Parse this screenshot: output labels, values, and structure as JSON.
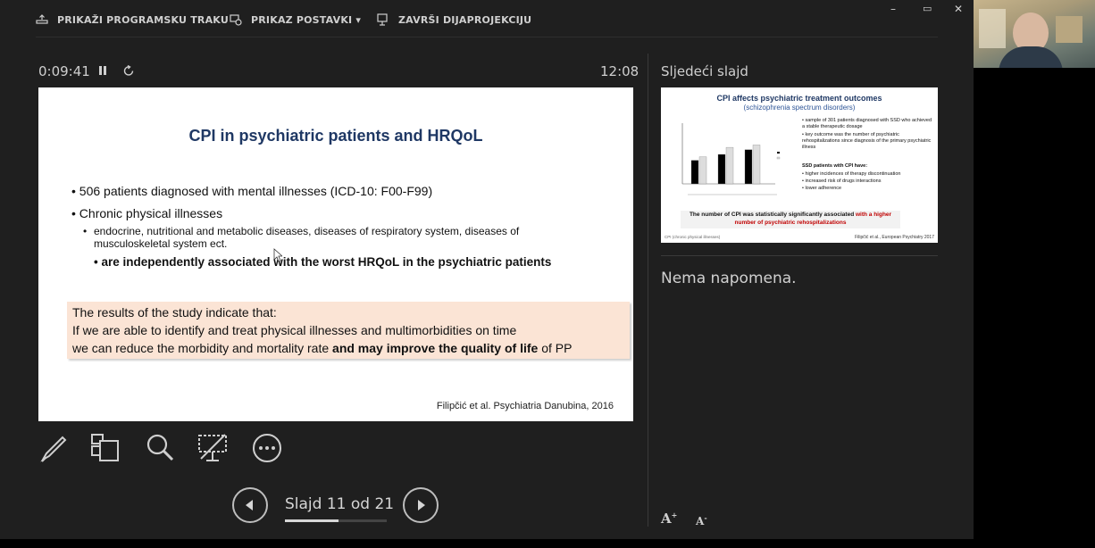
{
  "toolbar": {
    "show_taskbar": "PRIKAŽI PROGRAMSKU TRAKU",
    "display_settings": "PRIKAZ POSTAVKI ▾",
    "end_slideshow": "ZAVRŠI DIJAPROJEKCIJU"
  },
  "window_controls": {
    "minimize": "–",
    "restore": "▭",
    "close": "✕"
  },
  "presenter": {
    "elapsed_time": "0:09:41",
    "current_time": "12:08"
  },
  "current_slide": {
    "title": "CPI in psychiatric patients and HRQoL",
    "bullet1": "• 506 patients diagnosed with mental illnesses (ICD-10: F00-F99)",
    "bullet2": "• Chronic physical illnesses",
    "sub1": "endocrine, nutritional and metabolic diseases, diseases of respiratory system, diseases of musculoskeletal system ect.",
    "sub2": "• are independently associated with the worst HRQoL in the psychiatric patients",
    "box_line1": "The results of the study indicate that:",
    "box_line2": "If we are able to identify and treat physical illnesses and multimorbidities on time",
    "box_line3_a": "we can reduce the morbidity and mortality rate ",
    "box_line3_b": "and may improve the quality of life",
    "box_line3_c": " of PP",
    "citation": "Filipčić et al. Psychiatria Danubina, 2016"
  },
  "navigation": {
    "slide_counter": "Slajd 11 od 21",
    "progress": 0.524
  },
  "next_slide": {
    "label": "Sljedeći slajd",
    "title": "CPI affects psychiatric treatment outcomes",
    "subtitle": "(schizophrenia spectrum disorders)",
    "r1": "• sample of 301 patients diagnosed with SSD who achieved a stable therapeutic dosage",
    "r2": "• key outcome was the number of psychiatric rehospitalizations since diagnosis of the primary psychiatric illness",
    "r3": "SSD patients with CPI have:",
    "r4": "• higher incidences of therapy discontinuation",
    "r5": "• increased risk of drugs interactions",
    "r6": "• lower adherence",
    "bottom_a": "The number of CPI was statistically significantly associated ",
    "bottom_b": "with a higher number of psychiatric rehospitalizations",
    "foot_left": "CPI (chronic physical illnesses)",
    "foot_right": "Filipčić et al., European Psychiatry 2017",
    "chart_bars": [
      0.4,
      0.46,
      0.5,
      0.62,
      0.58,
      0.66
    ]
  },
  "notes": {
    "text": "Nema napomena."
  },
  "font_controls": {
    "increase": "A",
    "decrease": "A"
  },
  "colors": {
    "background": "#1f1f1f",
    "slide_title": "#1f3864",
    "highlight_box": "#fbe4d5",
    "red_text": "#c00000"
  }
}
